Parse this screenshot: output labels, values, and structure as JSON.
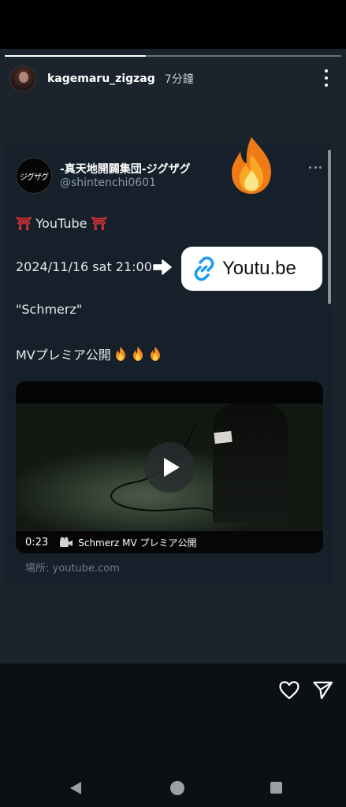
{
  "story": {
    "username": "kagemaru_zigzag",
    "time_ago": "7分鐘",
    "progress_fraction": 0.42
  },
  "post": {
    "author_name": "-真天地開闢集団-ジグザグ",
    "author_handle": "@shintenchi0601",
    "avatar_text": "ジグザグ",
    "line_youtube_text": "YouTube",
    "torii_emoji": "⛩",
    "line_date": "2024/11/16 sat 21:00",
    "line_title": "\"Schmerz\"",
    "line_premiere": "MVプレミア公開",
    "source": "場所: youtube.com"
  },
  "sticker": {
    "link_text": "Youtu.be"
  },
  "video": {
    "duration": "0:23",
    "title": "Schmerz MV プレミア公開"
  },
  "colors": {
    "background": "#1b232c",
    "card": "#15202b",
    "torii_red": "#e0332f",
    "link_blue": "#1d9bf0"
  },
  "icons": {
    "story_more": "more-vertical-icon",
    "post_more": "more-horizontal-icon",
    "fire": "fire-icon",
    "arrow": "arrow-right-icon",
    "link": "link-icon",
    "play": "play-icon",
    "camera": "video-camera-icon",
    "heart": "heart-icon",
    "send": "send-icon",
    "nav_back": "nav-back-icon",
    "nav_home": "nav-home-icon",
    "nav_recents": "nav-recents-icon"
  }
}
